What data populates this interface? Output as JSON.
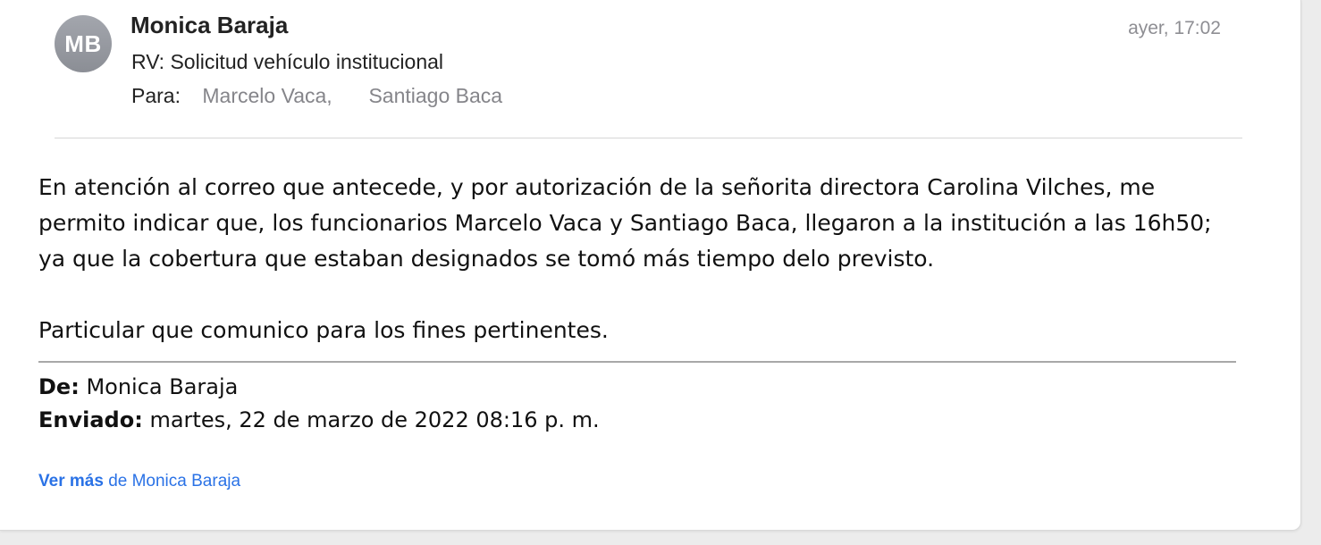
{
  "message": {
    "avatar_initials": "MB",
    "sender": "Monica Baraja",
    "timestamp": "ayer, 17:02",
    "subject": "RV: Solicitud vehículo institucional",
    "to_label": "Para:",
    "recipients": [
      "Marcelo Vaca,",
      "Santiago Baca"
    ]
  },
  "body": {
    "lines": [
      "En atención al correo que antecede, y por autorización de la señorita directora Carolina Vilches, me",
      "permito indicar que, los funcionarios Marcelo Vaca y Santiago Baca, llegaron a la institución a las 16h50;",
      "ya que la cobertura que estaban designados se tomó más tiempo delo previsto."
    ],
    "closing": "Particular que comunico para los fines pertinentes."
  },
  "quoted": {
    "from_label": "De:",
    "from_value": "Monica Baraja",
    "sent_label": "Enviado:",
    "sent_value": "martes, 22 de marzo de 2022 08:16 p. m."
  },
  "footer": {
    "see_more_bold": "Ver más",
    "see_more_rest": "de Monica Baraja"
  },
  "colors": {
    "avatar": "#9a9ca3",
    "link": "#2a72e6",
    "muted": "#8e8e93"
  }
}
